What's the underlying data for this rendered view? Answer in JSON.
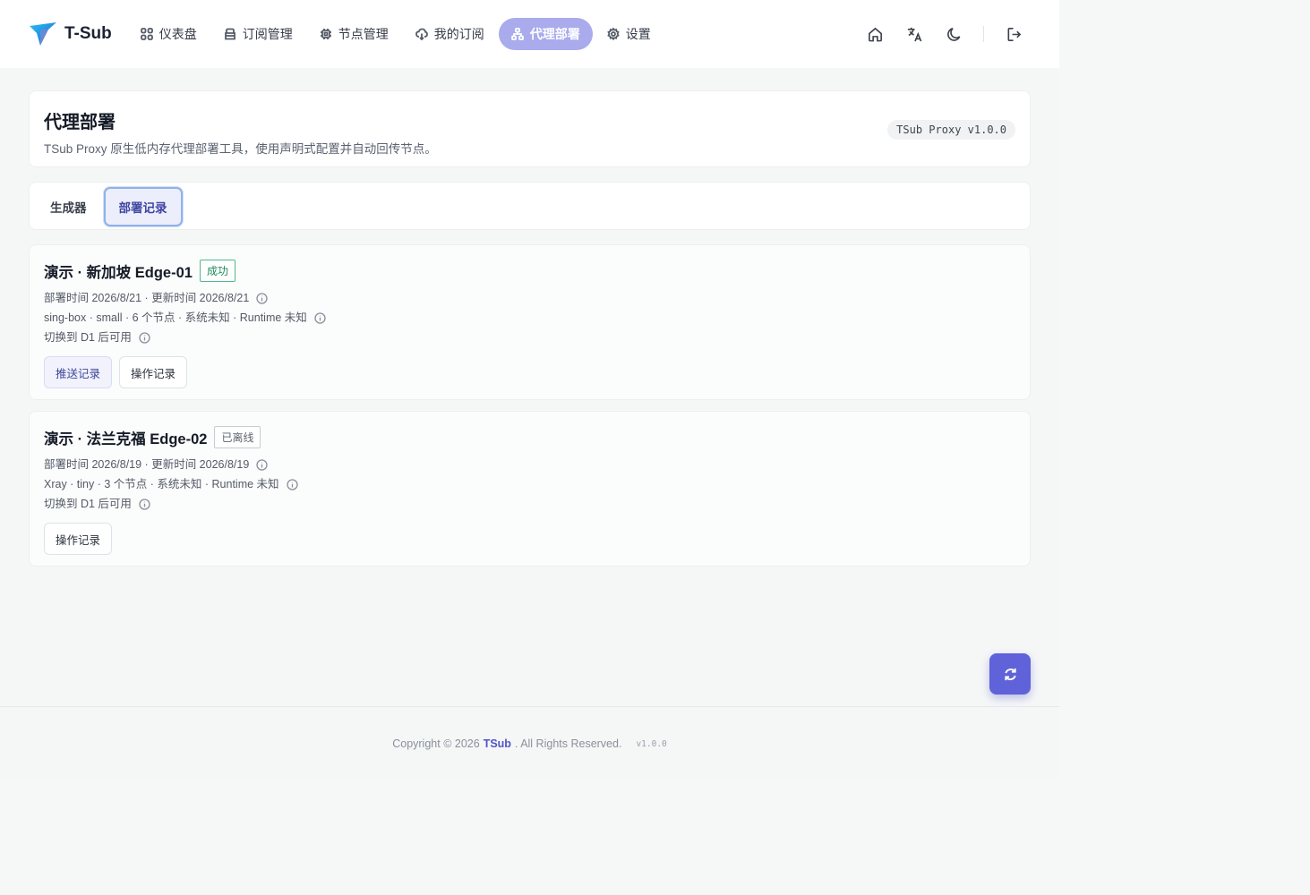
{
  "app": {
    "name": "T-Sub"
  },
  "nav": [
    {
      "label": "仪表盘",
      "icon": "grid-icon"
    },
    {
      "label": "订阅管理",
      "icon": "folder-icon"
    },
    {
      "label": "节点管理",
      "icon": "chip-icon"
    },
    {
      "label": "我的订阅",
      "icon": "cloud-download-icon"
    },
    {
      "label": "代理部署",
      "icon": "network-icon",
      "active": true
    },
    {
      "label": "设置",
      "icon": "gear-icon"
    }
  ],
  "header_actions": [
    "home-icon",
    "translate-icon",
    "moon-icon",
    "logout-icon"
  ],
  "page": {
    "title": "代理部署",
    "description": "TSub Proxy 原生低内存代理部署工具，使用声明式配置并自动回传节点。",
    "version_badge": "TSub Proxy v1.0.0"
  },
  "tabs": [
    {
      "label": "生成器",
      "active": false
    },
    {
      "label": "部署记录",
      "active": true
    }
  ],
  "deployments": [
    {
      "title": "演示 · 新加坡 Edge-01",
      "status": "成功",
      "status_type": "success",
      "time_line": "部署时间 2026/8/21 · 更新时间 2026/8/21",
      "spec_line": "sing-box · small · 6 个节点 · 系统未知 · Runtime 未知",
      "note_line": "切换到 D1 后可用",
      "buttons": [
        "推送记录",
        "操作记录"
      ]
    },
    {
      "title": "演示 · 法兰克福 Edge-02",
      "status": "已离线",
      "status_type": "offline",
      "time_line": "部署时间 2026/8/19 · 更新时间 2026/8/19",
      "spec_line": "Xray · tiny · 3 个节点 · 系统未知 · Runtime 未知",
      "note_line": "切换到 D1 后可用",
      "buttons": [
        "操作记录"
      ]
    }
  ],
  "fab": {
    "icon": "refresh-icon"
  },
  "footer": {
    "copyright": "Copyright © 2026",
    "brand": "TSub",
    "rights": ". All Rights Reserved.",
    "version": "v1.0.0"
  },
  "colors": {
    "accent": "#5f62d8",
    "nav_active_bg": "#a9abec",
    "success": "#1f8a5c"
  }
}
